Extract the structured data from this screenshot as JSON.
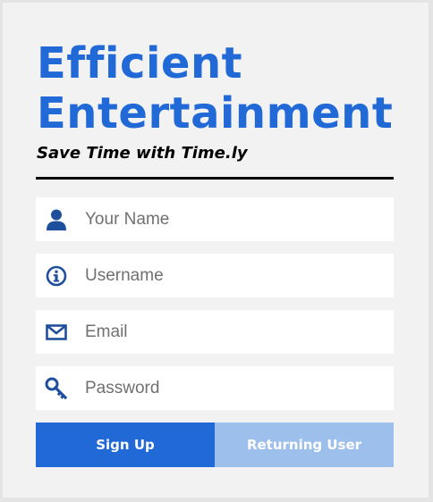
{
  "brand": {
    "line1": "Efficient",
    "line2": "Entertainment"
  },
  "tagline": "Save Time with Time.ly",
  "colors": {
    "accent": "#2169d6",
    "accent_light": "#9dbfeb",
    "icon": "#1f4f9c"
  },
  "form": {
    "fields": [
      {
        "icon": "person-icon",
        "placeholder": "Your Name",
        "value": ""
      },
      {
        "icon": "info-icon",
        "placeholder": "Username",
        "value": ""
      },
      {
        "icon": "envelope-icon",
        "placeholder": "Email",
        "value": ""
      },
      {
        "icon": "key-icon",
        "placeholder": "Password",
        "value": ""
      }
    ]
  },
  "buttons": {
    "signup": "Sign Up",
    "returning": "Returning User"
  }
}
